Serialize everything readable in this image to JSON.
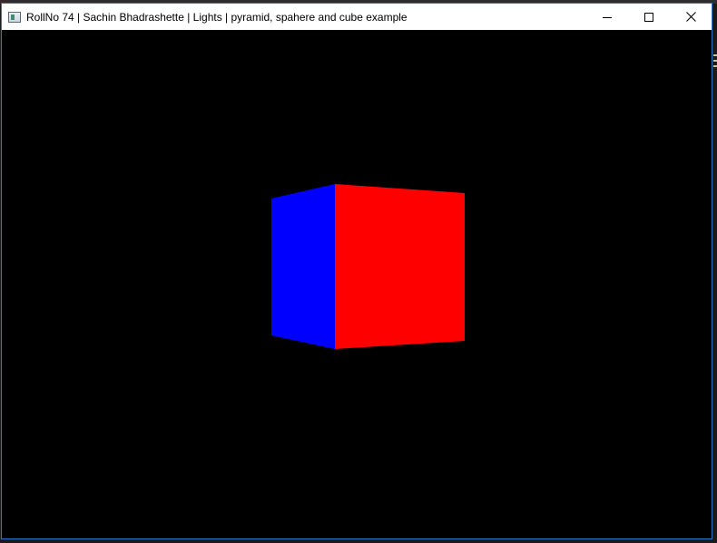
{
  "window": {
    "title": "RollNo 74 | Sachin Bhadrashette | Lights | pyramid, spahere and cube example",
    "icon": "opengl-app-icon",
    "buttons": {
      "minimize": "minimize-icon",
      "maximize": "maximize-icon",
      "close": "close-icon"
    }
  },
  "scene": {
    "background": "#000000",
    "cube": {
      "front_face_color": "#ff0000",
      "side_face_color": "#0000ff"
    }
  },
  "colors": {
    "window_border": "#2b78c4",
    "titlebar": "#ffffff"
  }
}
